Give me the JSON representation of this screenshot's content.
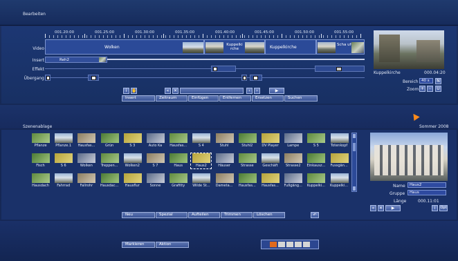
{
  "window": {
    "title": "Bearbeiten",
    "date": "Sommer 2008"
  },
  "timeline": {
    "ruler": [
      "00:1.20:00",
      "00:1.25:00",
      "00:1.30:00",
      "00:1.35:00",
      "00:1.40:00",
      "00:1.45:00",
      "00:1.50:00",
      "00:1.55:00"
    ],
    "ruler_display": [
      "001.20:00",
      "001.25:00",
      "001.30:00",
      "001.35:00",
      "001.40:00",
      "001.45:00",
      "001.50:00",
      "001.55:00"
    ],
    "tracks": [
      "Video",
      "Insert",
      "Effekt",
      "Übergang"
    ],
    "video_clips": [
      "Wolken",
      "Kuppelki\nrche",
      "Kuppelkirche",
      "Scha\nufe..."
    ],
    "insert_clip": "Reh2"
  },
  "timeline_buttons": [
    "Insert",
    "Zeitraum",
    "Einfügen",
    "Entfernen",
    "Ersetzen",
    "Suchen"
  ],
  "preview": {
    "clip_name": "Kuppelkirche",
    "time": "000.04:20",
    "bereich_label": "Bereich",
    "bereich_value": "40 s",
    "bereich_btn": "N",
    "zoom_label": "Zoom",
    "zoom_plus": "+",
    "zoom_minus": "-",
    "zoom_u": "U"
  },
  "bin": {
    "title": "Szenenablage",
    "items": [
      [
        "Pflanze",
        "Pflanze.1",
        "Hausfas...",
        "Grün",
        "S 3",
        "Auto Ka",
        "Hausfas...",
        "S 4",
        "Stuhl",
        "Stuhl2",
        "DV Player",
        "Lampe",
        "S 5",
        "Totenkopf"
      ],
      [
        "Fisch",
        "S 6",
        "Wolken",
        "Treppen...",
        "Wolken2",
        "S 7",
        "Haus",
        "Haus2",
        "Häuser",
        "Strasse",
        "Geschäft",
        "Strasse2",
        "Einkausz...",
        "Fussgän..."
      ],
      [
        "Hausdach",
        "Fahrrad",
        "Fallrohr",
        "Hausdac...",
        "Hausflur",
        "Sonne",
        "Grafitty",
        "Wilde St...",
        "Dameta...",
        "Hausfas...",
        "Hausfas...",
        "Fußgäng...",
        "Kuppelki...",
        "Kuppelki..."
      ]
    ],
    "name_label": "Name",
    "name_value": "Haus2",
    "gruppe_label": "Gruppe",
    "gruppe_value": "Haus",
    "laenge_label": "Länge",
    "laenge_value": "000.11:01",
    "info_btn": "i",
    "opt_btn": "Opt"
  },
  "bin_buttons": [
    "Neu",
    "Spezial",
    "Aufteilen",
    "Trimmen",
    "Löschen"
  ],
  "bottom_buttons": [
    "Markieren",
    "Aktion"
  ],
  "icons": [
    "tools-icon",
    "cut-icon",
    "text-icon",
    "title-icon",
    "home-icon"
  ],
  "colors": {
    "accent": "#3a5496",
    "bg": "#172b5e",
    "cursor": "#ff8a1a"
  }
}
